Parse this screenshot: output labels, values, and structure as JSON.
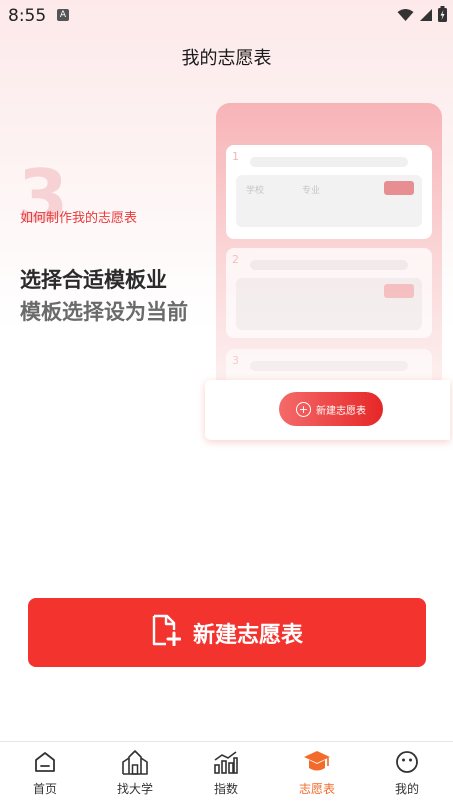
{
  "status_bar": {
    "time": "8:55",
    "notif": "A"
  },
  "header": {
    "title": "我的志愿表"
  },
  "intro": {
    "step_number": "3",
    "section_title": "如何制作我的志愿表",
    "headline_line1": "选择合适模板业",
    "headline_line2": "模板选择设为当前"
  },
  "illustration": {
    "rows": [
      "1",
      "2",
      "3"
    ],
    "col_school": "学校",
    "col_major": "专业",
    "new_button_label": "新建志愿表"
  },
  "main_button": {
    "label": "新建志愿表"
  },
  "bottom_nav": {
    "items": [
      {
        "label": "首页"
      },
      {
        "label": "找大学"
      },
      {
        "label": "指数"
      },
      {
        "label": "志愿表"
      },
      {
        "label": "我的"
      }
    ],
    "active_color": "#f26b2b"
  },
  "colors": {
    "accent": "#f2332e"
  }
}
